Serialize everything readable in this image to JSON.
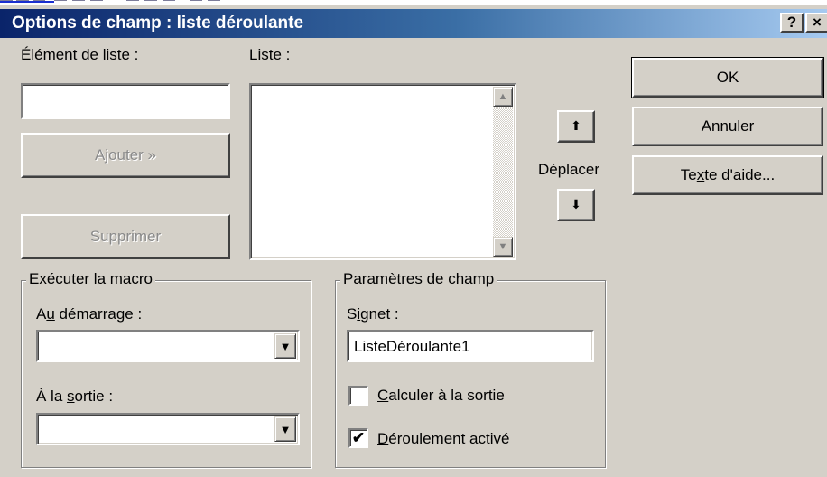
{
  "dialog": {
    "title": "Options de champ : liste déroulante",
    "help_button": "?",
    "close_button": "×"
  },
  "item": {
    "label_pre": "Élémen",
    "label_key": "t",
    "label_post": " de liste :",
    "value": "",
    "add_label": "Ajouter »",
    "remove_label": "Supprimer"
  },
  "list": {
    "label_key": "L",
    "label_post": "iste :",
    "items": []
  },
  "move": {
    "label": "Déplacer",
    "up_icon": "arrow-up-icon",
    "down_icon": "arrow-down-icon"
  },
  "buttons": {
    "ok": "OK",
    "cancel": "Annuler",
    "help_pre": "Te",
    "help_key": "x",
    "help_post": "te d'aide..."
  },
  "macro": {
    "group_label": "Exécuter la macro",
    "on_entry_pre": "A",
    "on_entry_key": "u",
    "on_entry_post": " démarrage :",
    "on_entry_value": "",
    "on_exit_pre": "À la ",
    "on_exit_key": "s",
    "on_exit_post": "ortie :",
    "on_exit_value": ""
  },
  "settings": {
    "group_label": "Paramètres de champ",
    "bookmark_pre": "S",
    "bookmark_key": "i",
    "bookmark_post": "gnet :",
    "bookmark_value": "ListeDéroulante1",
    "calc_key": "C",
    "calc_post": "alculer à la sortie",
    "calc_checked": false,
    "enabled_key": "D",
    "enabled_post": "éroulement activé",
    "enabled_checked": true
  },
  "colors": {
    "title_start": "#0a246a",
    "title_end": "#a6caf0",
    "face": "#d4d0c8"
  }
}
